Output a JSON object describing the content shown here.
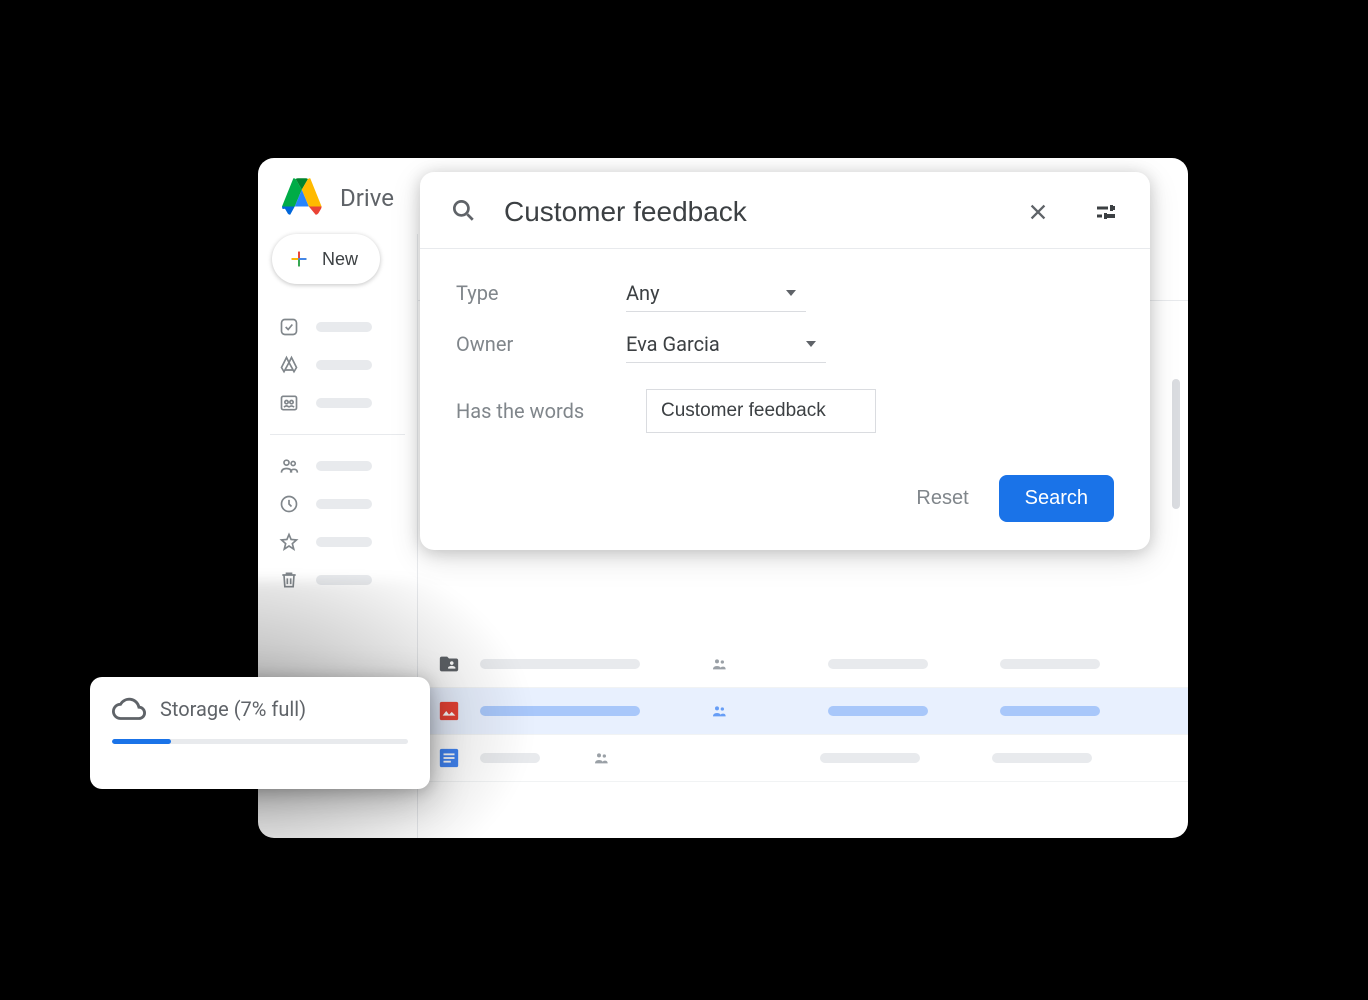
{
  "app": {
    "title": "Drive"
  },
  "sidebar": {
    "new_label": "New"
  },
  "search": {
    "query": "Customer feedback",
    "filters": {
      "type_label": "Type",
      "type_value": "Any",
      "owner_label": "Owner",
      "owner_value": "Eva Garcia",
      "words_label": "Has the words",
      "words_value": "Customer feedback"
    },
    "reset_label": "Reset",
    "search_label": "Search"
  },
  "storage": {
    "label": "Storage (7% full)",
    "percent": 7
  }
}
